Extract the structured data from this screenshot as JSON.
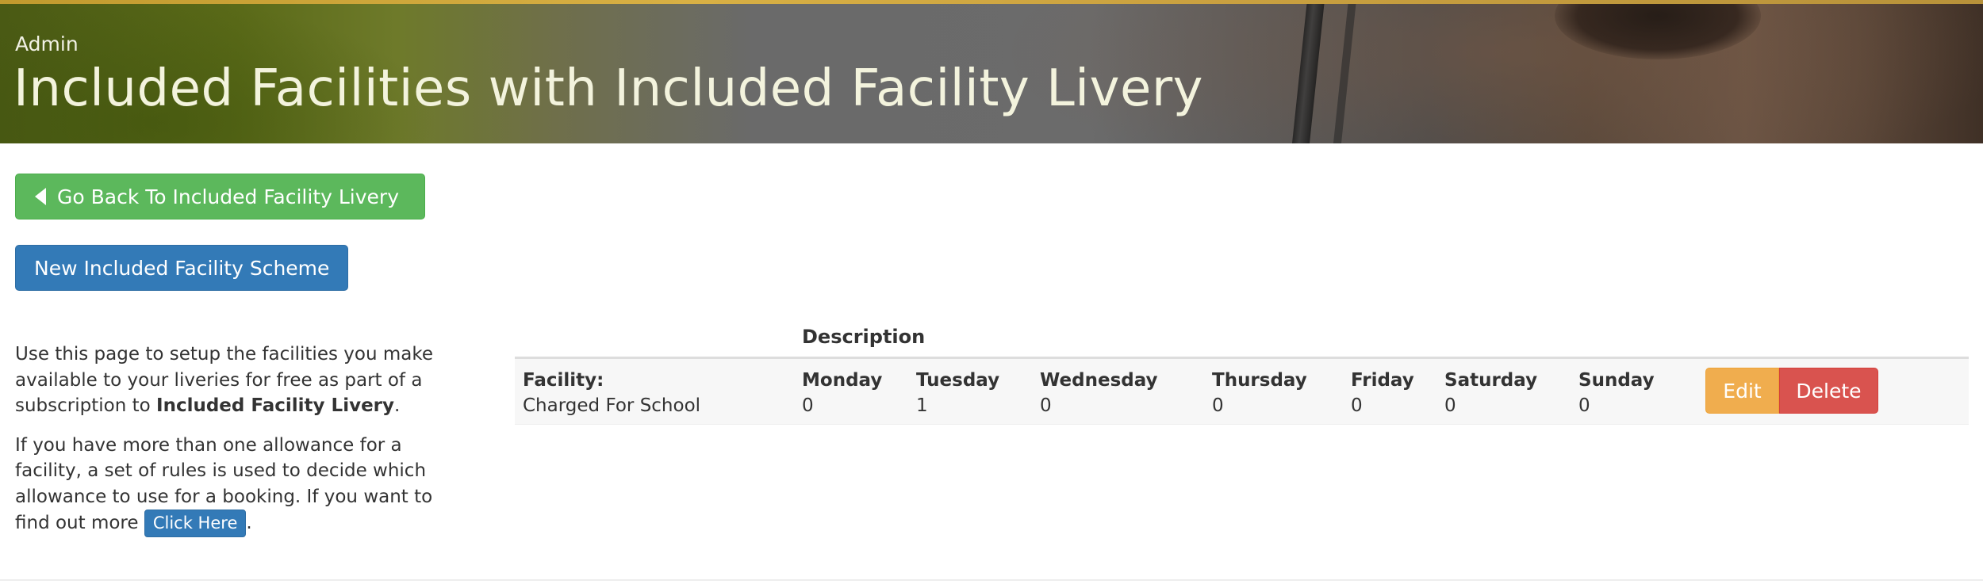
{
  "header": {
    "breadcrumb": "Admin",
    "title": "Included Facilities with Included Facility Livery"
  },
  "actions": {
    "back_label": "Go Back To Included Facility Livery",
    "new_label": "New Included Facility Scheme"
  },
  "help": {
    "p1_pre": "Use this page to setup the facilities you make available to your liveries for free as part of a subscription to ",
    "p1_bold": "Included Facility Livery",
    "p1_post": ".",
    "p2_pre": "If you have more than one allowance for a facility, a set of rules is used to decide which allowance to use for a booking. If you want to find out more ",
    "p2_link": "Click Here",
    "p2_post": "."
  },
  "table": {
    "header": "Description",
    "rows": [
      {
        "facility_label": "Facility:",
        "facility_value": "Charged For School",
        "days": [
          {
            "label": "Monday",
            "value": "0"
          },
          {
            "label": "Tuesday",
            "value": "1"
          },
          {
            "label": "Wednesday",
            "value": "0"
          },
          {
            "label": "Thursday",
            "value": "0"
          },
          {
            "label": "Friday",
            "value": "0"
          },
          {
            "label": "Saturday",
            "value": "0"
          },
          {
            "label": "Sunday",
            "value": "0"
          }
        ],
        "edit_label": "Edit",
        "delete_label": "Delete"
      }
    ]
  },
  "colors": {
    "success": "#5cb85c",
    "primary": "#337ab7",
    "warning": "#f0ad4e",
    "danger": "#d9534f"
  }
}
